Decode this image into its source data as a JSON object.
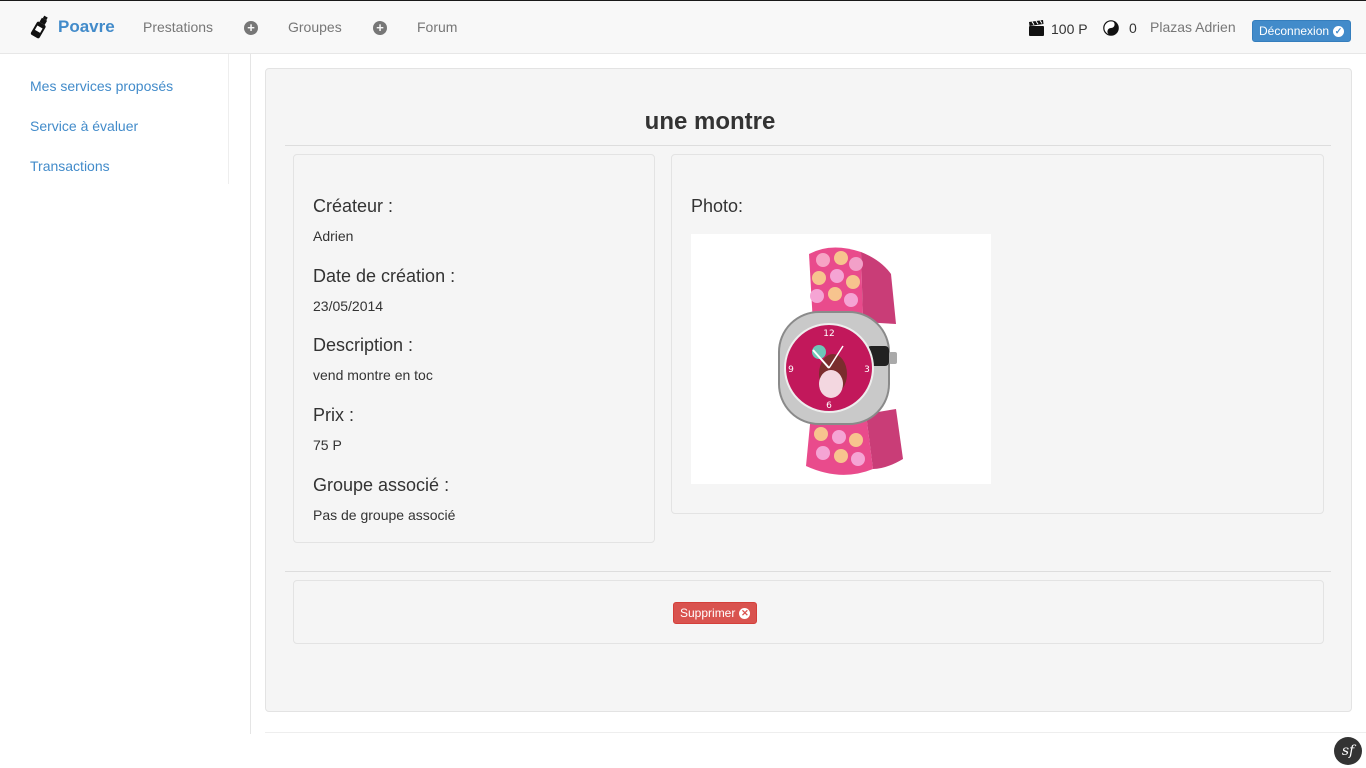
{
  "nav": {
    "brand": "Poavre",
    "links": [
      "Prestations",
      "Groupes",
      "Forum"
    ],
    "points": "100 P",
    "karma": "0",
    "user": "Plazas Adrien",
    "logout": "Déconnexion"
  },
  "sidebar": {
    "items": [
      "Mes services proposés",
      "Service à évaluer",
      "Transactions"
    ]
  },
  "service": {
    "title": "une montre",
    "creator_label": "Créateur :",
    "creator": "Adrien",
    "date_label": "Date de création :",
    "date": "23/05/2014",
    "description_label": "Description :",
    "description": "vend montre en toc",
    "price_label": "Prix :",
    "price": "75 P",
    "group_label": "Groupe associé :",
    "group": "Pas de groupe associé",
    "photo_label": "Photo:"
  },
  "actions": {
    "delete": "Supprimer"
  },
  "footer": {
    "badge": "sf"
  },
  "colors": {
    "link": "#428bca",
    "danger": "#d9534f",
    "watch_pink": "#e94b8c"
  }
}
